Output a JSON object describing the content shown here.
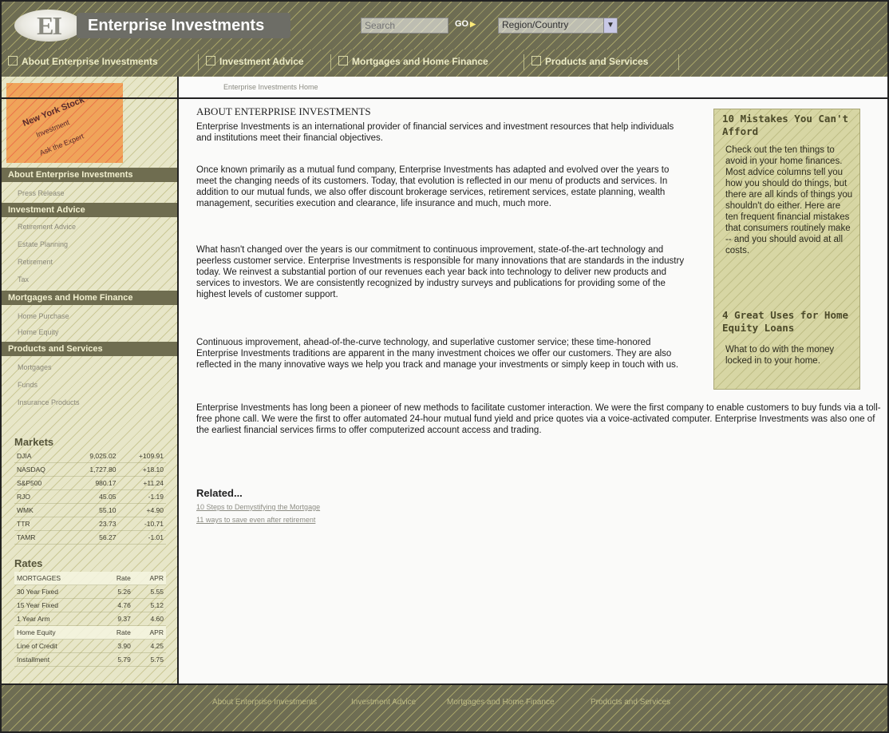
{
  "header": {
    "logo_text": "EI",
    "brand": "Enterprise Investments",
    "search_placeholder": "Search",
    "go_label": "GO",
    "region_label": "Region/Country"
  },
  "nav": {
    "items": [
      {
        "label": "About Enterprise Investments"
      },
      {
        "label": "Investment Advice"
      },
      {
        "label": "Mortgages and Home Finance"
      },
      {
        "label": "Products and Services"
      }
    ]
  },
  "breadcrumb": "Enterprise Investments Home",
  "promo": {
    "line1": "New York Stock",
    "line2": "Investment",
    "line3": "Ask the Expert"
  },
  "sidebar": {
    "sections": [
      {
        "title": "About Enterprise Investments",
        "links": [
          "Press Release"
        ]
      },
      {
        "title": "Investment Advice",
        "links": [
          "Retirement Advice",
          "Estate Planning",
          "Retirement",
          "Tax"
        ]
      },
      {
        "title": "Mortgages and Home Finance",
        "links": [
          "Home Purchase",
          "Home Equity"
        ]
      },
      {
        "title": "Products and Services",
        "links": [
          "Mortgages",
          "Funds",
          "Insurance Products"
        ]
      }
    ]
  },
  "markets": {
    "title": "Markets",
    "rows": [
      [
        "DJIA",
        "9,025.02",
        "+109.91"
      ],
      [
        "NASDAQ",
        "1,727.80",
        "+18.10"
      ],
      [
        "S&P500",
        "980.17",
        "+11.24"
      ],
      [
        "RJO",
        "45.05",
        "-1.19"
      ],
      [
        "WMK",
        "55.10",
        "+4.90"
      ],
      [
        "TTR",
        "23.73",
        "-10.71"
      ],
      [
        "TAMR",
        "56.27",
        "-1.01"
      ]
    ]
  },
  "rates": {
    "title": "Rates",
    "rows": [
      [
        "MORTGAGES",
        "Rate",
        "APR"
      ],
      [
        "30 Year Fixed",
        "5.26",
        "5.55"
      ],
      [
        "15 Year Fixed",
        "4.76",
        "5.12"
      ],
      [
        "1 Year Arm",
        "9.37",
        "4.60"
      ],
      [
        "Home Equity",
        "Rate",
        "APR"
      ],
      [
        "Line of Credit",
        "3.90",
        "4.25"
      ],
      [
        "Installment",
        "5.79",
        "5.75"
      ]
    ]
  },
  "main": {
    "title": "ABOUT ENTERPRISE INVESTMENTS",
    "paragraphs": [
      "Enterprise Investments is an international provider of financial services and investment resources that help individuals and institutions meet their financial objectives.",
      "Once known primarily as a mutual fund company, Enterprise Investments has adapted and evolved over the years to meet the changing needs of its customers. Today, that evolution is reflected in our menu of products and services. In addition to our mutual funds, we also offer discount brokerage services, retirement services, estate planning, wealth management, securities execution and clearance, life insurance and much, much more.",
      "What hasn't changed over the years is our commitment to continuous improvement, state-of-the-art technology and peerless customer service. Enterprise Investments is responsible for many innovations that are standards in the industry today. We reinvest a substantial portion of our revenues each year back into technology to deliver new products and services to investors. We are consistently recognized by industry surveys and publications for providing some of the highest levels of customer support.",
      "Continuous improvement, ahead-of-the-curve technology, and superlative customer service; these time-honored Enterprise Investments traditions are apparent in the many investment choices we offer our customers. They are also reflected in the many innovative ways we help you track and manage your investments or simply keep in touch with us.",
      "Enterprise Investments has long been a pioneer of new methods to facilitate customer interaction. We were the first company to enable customers to buy funds via a toll-free phone call. We were the first to offer automated 24-hour mutual fund yield and price quotes via a voice-activated computer. Enterprise Investments was also one of the earliest financial services firms to offer computerized account access and trading."
    ],
    "related_title": "Related...",
    "related_links": [
      "10 Steps to Demystifying the Mortgage",
      "11 ways to save even after retirement"
    ]
  },
  "rightbox": {
    "title1": "10 Mistakes You Can't Afford",
    "text1": "Check out the ten things to avoid in your home finances. Most advice columns tell you how you should do things, but there are all kinds of things you shouldn't do either. Here are ten frequent financial mistakes that consumers routinely make -- and you should avoid at all costs.",
    "title2": "4 Great Uses for Home Equity Loans",
    "text2": "What to do with the money locked in to your home."
  },
  "footer": {
    "links": [
      "About Enterprise Investments",
      "Investment Advice",
      "Mortgages and Home Finance",
      "Products and Services"
    ]
  },
  "colors": {
    "dark_olive": "#6e6d53",
    "light_olive": "#e7e6c8",
    "box": "#d7d6a4",
    "promo": "#f0a45a"
  }
}
